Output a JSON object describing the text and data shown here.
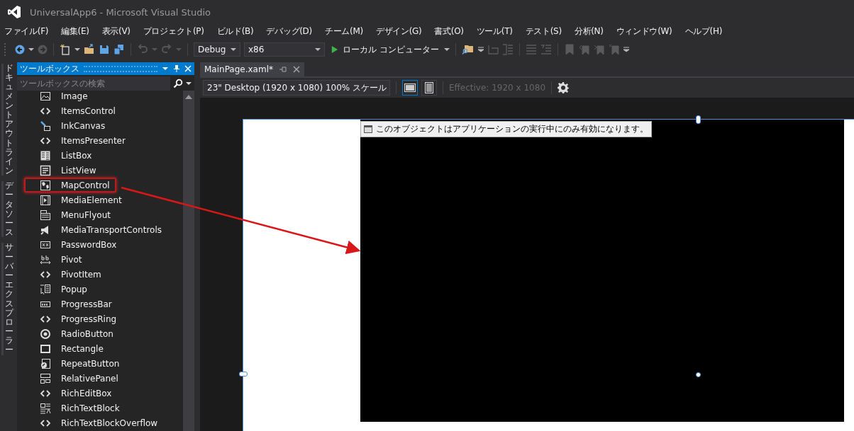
{
  "window": {
    "title": "UniversalApp6 - Microsoft Visual Studio"
  },
  "menu": [
    "ファイル(F)",
    "編集(E)",
    "表示(V)",
    "プロジェクト(P)",
    "ビルド(B)",
    "デバッグ(D)",
    "チーム(M)",
    "デザイン(G)",
    "書式(O)",
    "ツール(T)",
    "テスト(S)",
    "分析(N)",
    "ウィンドウ(W)",
    "ヘルプ(H)"
  ],
  "toolbar": {
    "configuration": "Debug",
    "platform": "x86",
    "run_target": "ローカル コンピューター"
  },
  "side_tabs": [
    "ドキュメントアウトライン",
    "データソース",
    "サーバーエクスプローラー"
  ],
  "toolbox": {
    "title": "ツールボックス",
    "search": {
      "placeholder": "ツールボックスの検索"
    },
    "items": [
      {
        "label": "Image",
        "highlighted": false
      },
      {
        "label": "ItemsControl",
        "highlighted": false
      },
      {
        "label": "InkCanvas",
        "highlighted": false
      },
      {
        "label": "ItemsPresenter",
        "highlighted": false
      },
      {
        "label": "ListBox",
        "highlighted": false
      },
      {
        "label": "ListView",
        "highlighted": false
      },
      {
        "label": "MapControl",
        "highlighted": true
      },
      {
        "label": "MediaElement",
        "highlighted": false
      },
      {
        "label": "MenuFlyout",
        "highlighted": false
      },
      {
        "label": "MediaTransportControls",
        "highlighted": false
      },
      {
        "label": "PasswordBox",
        "highlighted": false
      },
      {
        "label": "Pivot",
        "highlighted": false
      },
      {
        "label": "PivotItem",
        "highlighted": false
      },
      {
        "label": "Popup",
        "highlighted": false
      },
      {
        "label": "ProgressBar",
        "highlighted": false
      },
      {
        "label": "ProgressRing",
        "highlighted": false
      },
      {
        "label": "RadioButton",
        "highlighted": false
      },
      {
        "label": "Rectangle",
        "highlighted": false
      },
      {
        "label": "RepeatButton",
        "highlighted": false
      },
      {
        "label": "RelativePanel",
        "highlighted": false
      },
      {
        "label": "RichEditBox",
        "highlighted": false
      },
      {
        "label": "RichTextBlock",
        "highlighted": false
      },
      {
        "label": "RichTextBlockOverflow",
        "highlighted": false
      }
    ]
  },
  "document_tab": {
    "title": "MainPage.xaml*",
    "selected": true
  },
  "designer": {
    "device": "23\" Desktop (1920 x 1080) 100% スケール",
    "views": [
      {
        "kind": "landscape",
        "selected": true
      },
      {
        "kind": "portrait",
        "selected": false
      }
    ],
    "effective": "Effective: 1920 x 1080",
    "tooltip": "このオブジェクトはアプリケーションの実行中にのみ有効になります。"
  }
}
